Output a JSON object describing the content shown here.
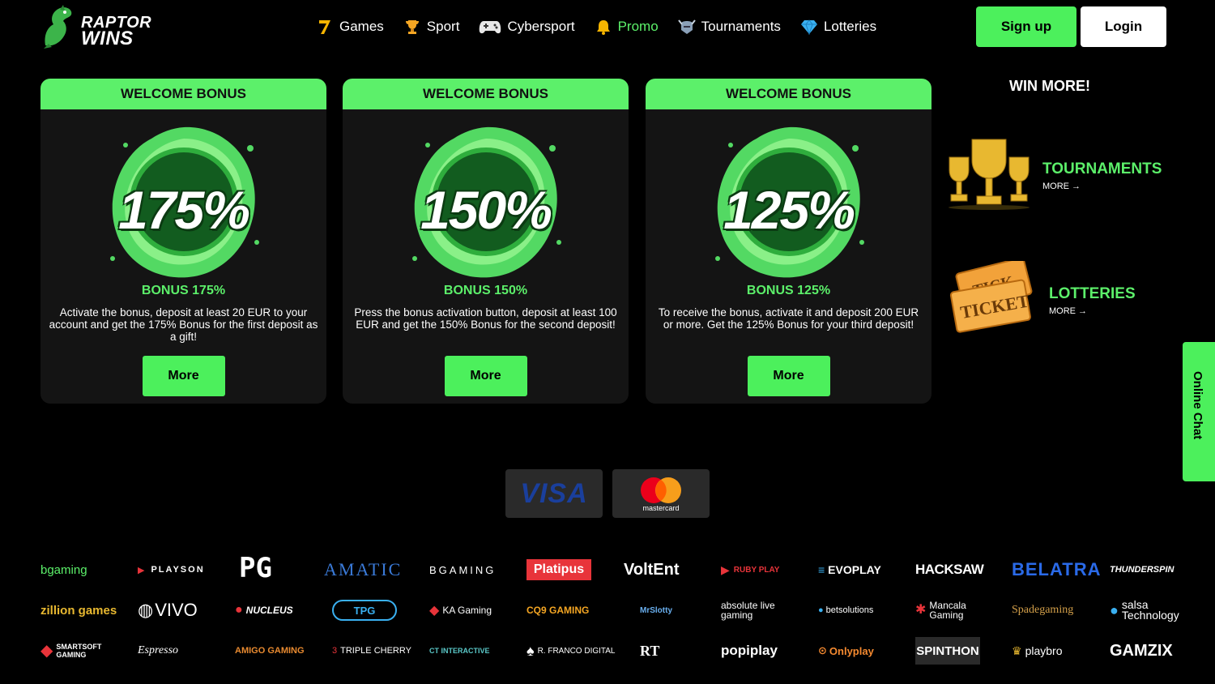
{
  "header": {
    "logo_line1": "RAPTOR",
    "logo_line2": "WINS",
    "nav": [
      {
        "label": "Games",
        "icon": "seven-icon",
        "active": false
      },
      {
        "label": "Sport",
        "icon": "trophy-icon",
        "active": false
      },
      {
        "label": "Cybersport",
        "icon": "gamepad-icon",
        "active": false
      },
      {
        "label": "Promo",
        "icon": "bell-icon",
        "active": true
      },
      {
        "label": "Tournaments",
        "icon": "helmet-icon",
        "active": false
      },
      {
        "label": "Lotteries",
        "icon": "diamond-icon",
        "active": false
      }
    ],
    "signup_label": "Sign up",
    "login_label": "Login"
  },
  "bonuses": [
    {
      "head": "WELCOME BONUS",
      "percent": "175%",
      "title": "BONUS 175%",
      "desc": "Activate the bonus, deposit at least 20 EUR to your account and get the 175% Bonus for the first deposit as a gift!",
      "button": "More"
    },
    {
      "head": "WELCOME BONUS",
      "percent": "150%",
      "title": "BONUS 150%",
      "desc": "Press the bonus activation button, deposit at least 100 EUR and get the 150% Bonus for the second deposit!",
      "button": "More"
    },
    {
      "head": "WELCOME BONUS",
      "percent": "125%",
      "title": "BONUS 125%",
      "desc": "To receive the bonus, activate it and deposit 200 EUR or more. Get the 125% Bonus for your third deposit!",
      "button": "More"
    }
  ],
  "win_more": {
    "title": "WIN MORE!",
    "items": [
      {
        "title": "TOURNAMENTS",
        "more": "MORE",
        "icon": "trophies-icon"
      },
      {
        "title": "LOTTERIES",
        "more": "MORE",
        "icon": "ticket-icon"
      }
    ]
  },
  "chat_label": "Online Chat",
  "payments": [
    {
      "label": "VISA",
      "icon": "visa-icon"
    },
    {
      "label": "mastercard",
      "icon": "mastercard-icon"
    }
  ],
  "providers": [
    [
      "bgaming",
      "PLAYSON",
      "PG",
      "AMATIC",
      "BGAMING",
      "Platipus",
      "VoltEnt",
      "RUBY PLAY",
      "EVOPLAY",
      "HACKSAW",
      "BELATRA",
      "THUNDERSPIN"
    ],
    [
      "zillion games",
      "VIVO",
      "NUCLEUS",
      "TPG",
      "KA Gaming",
      "CQ9 GAMING",
      "MrSlotty",
      "absolute live gaming",
      "betsolutions",
      "Mancala Gaming",
      "Spadegaming",
      "salsa Technology"
    ],
    [
      "SMARTSOFT GAMING",
      "Espresso",
      "AMIGO GAMING",
      "TRIPLE CHERRY",
      "CT INTERACTIVE",
      "R. FRANCO DIGITAL",
      "RT",
      "popiplay",
      "Onlyplay",
      "SPINTHON",
      "playbro",
      "GAMZIX"
    ]
  ],
  "colors": {
    "accent": "#5cf06a",
    "background": "#000000",
    "card": "#141414"
  }
}
